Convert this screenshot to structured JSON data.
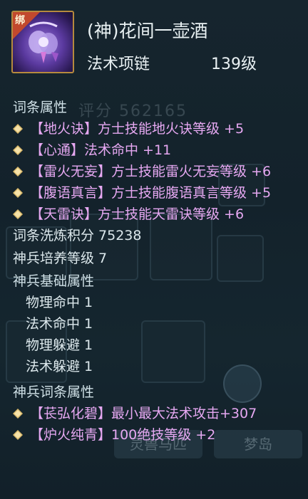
{
  "item": {
    "bind_badge": "绑",
    "name": "(神)花间一壶酒",
    "type": "法术项链",
    "level": "139级"
  },
  "background": {
    "score_label": "评分 562165",
    "tabs": [
      "灵兽马匹",
      "梦岛"
    ]
  },
  "affixes": {
    "header": "词条属性",
    "lines": [
      "【地火诀】方士技能地火诀等级 +5",
      "【心通】法术命中 +11",
      "【雷火无妄】方士技能雷火无妄等级 +6",
      "【腹语真言】方士技能腹语真言等级 +5",
      "【天雷诀】方士技能天雷诀等级 +6"
    ]
  },
  "refine_points": "词条洗炼积分 75238",
  "weapon_level": "神兵培养等级 7",
  "weapon_base": {
    "header": "神兵基础属性",
    "lines": [
      "物理命中 1",
      "法术命中 1",
      "物理躲避 1",
      "法术躲避 1"
    ]
  },
  "weapon_affixes": {
    "header": "神兵词条属性",
    "lines": [
      "【苌弘化碧】最小最大法术攻击+307",
      "【炉火纯青】100绝技等级 +2"
    ]
  },
  "colors": {
    "affix_text": "#e6a8f2",
    "normal_text": "#dce8ec",
    "diamond": "#d8b86a"
  },
  "icons": [
    "bind-badge",
    "necklace-item-icon",
    "gold-diamond-bullet-icon"
  ]
}
